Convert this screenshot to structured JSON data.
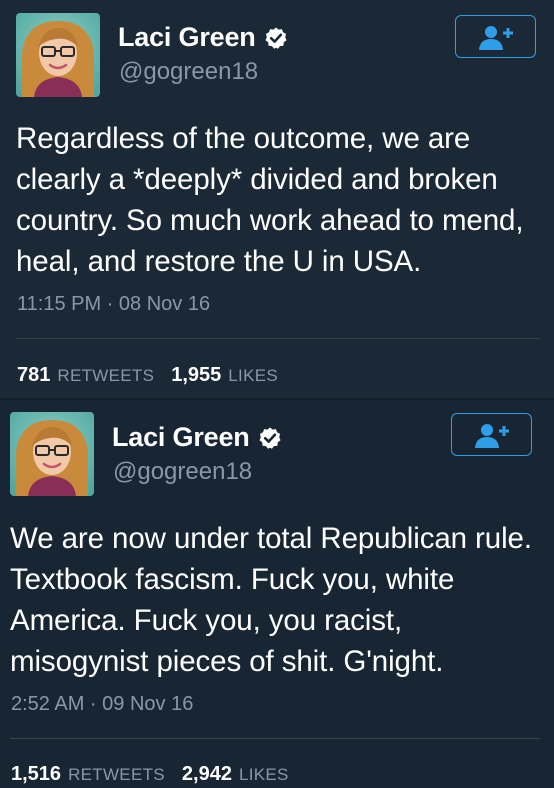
{
  "tweets": [
    {
      "author_name": "Laci Green",
      "handle": "@gogreen18",
      "text": "Regardless of the outcome, we are clearly a *deeply* divided and broken country. So much work ahead to mend, heal, and restore the U in USA.",
      "timestamp": "11:15 PM · 08 Nov 16",
      "retweets": "781",
      "retweets_label": "RETWEETS",
      "likes": "1,955",
      "likes_label": "LIKES"
    },
    {
      "author_name": "Laci Green",
      "handle": "@gogreen18",
      "text": "We are now under total Republican rule. Textbook fascism. Fuck you, white America. Fuck you, you racist, misogynist pieces of shit. G'night.",
      "timestamp": "2:52 AM · 09 Nov 16",
      "retweets": "1,516",
      "retweets_label": "RETWEETS",
      "likes": "2,942",
      "likes_label": "LIKES"
    }
  ],
  "colors": {
    "background": "#1b2836",
    "text": "#ffffff",
    "secondary_text": "#8899a6",
    "accent": "#2f9ee8"
  },
  "icons": {
    "verified": "verified-badge-icon",
    "follow": "add-user-icon"
  }
}
